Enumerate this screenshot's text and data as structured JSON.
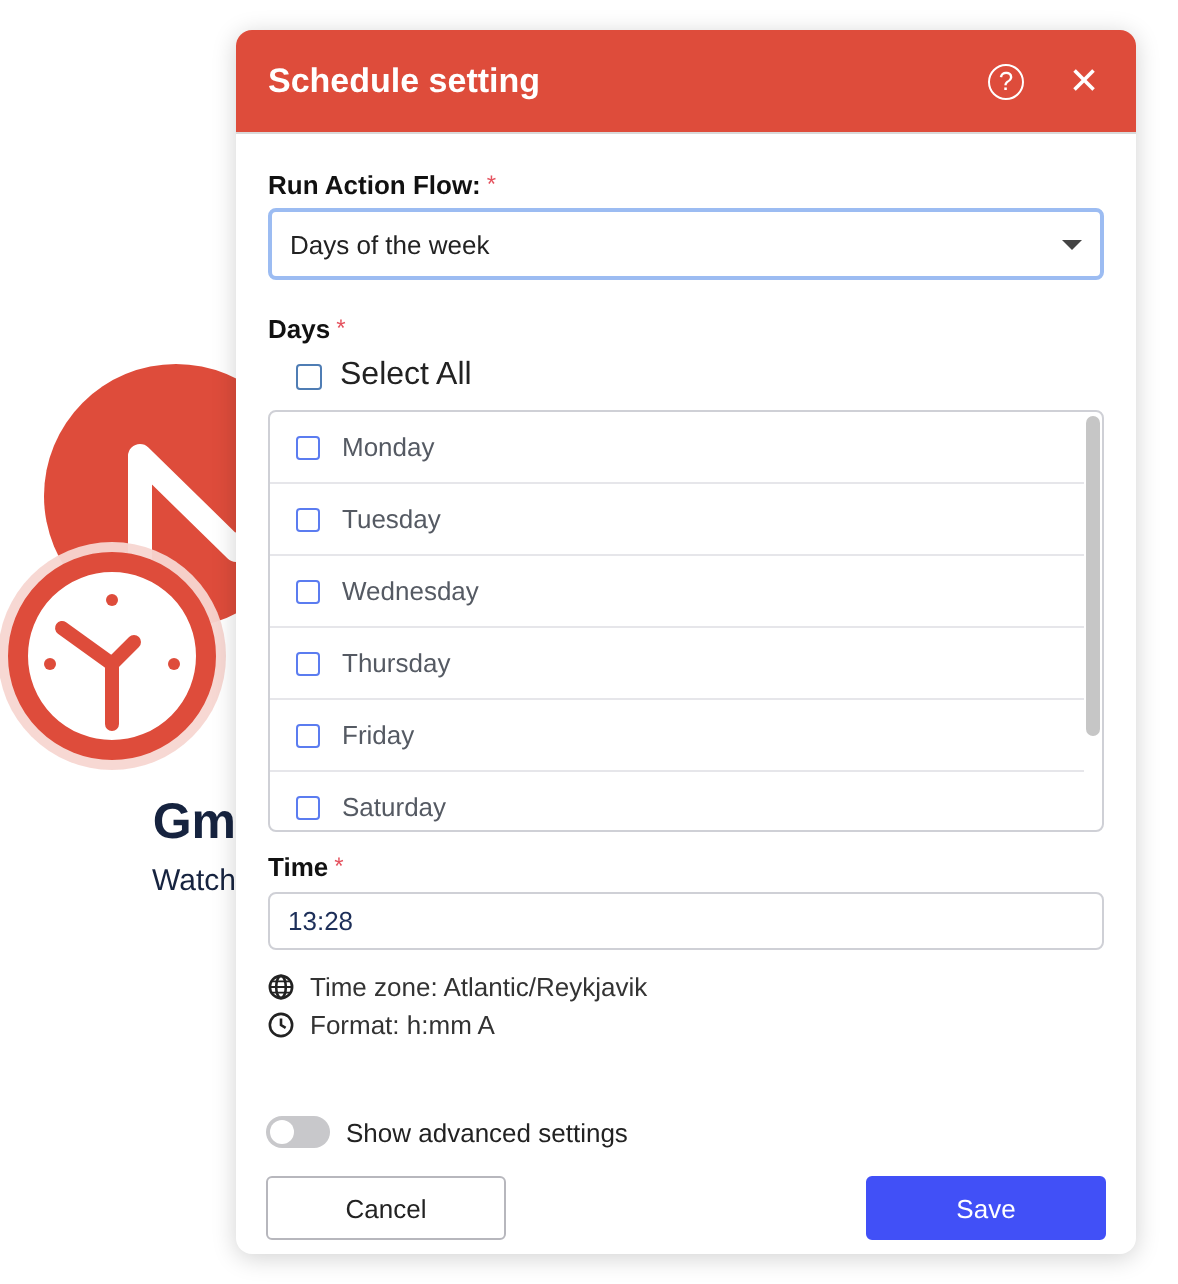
{
  "background": {
    "title": "Gm",
    "subtitle": "Watch"
  },
  "dialog": {
    "title": "Schedule setting",
    "help_icon": "?",
    "close_icon": "×"
  },
  "run_action_flow": {
    "label": "Run Action Flow:",
    "required_mark": "*",
    "value": "Days of the week"
  },
  "days": {
    "label": "Days",
    "required_mark": "*",
    "select_all": {
      "label": "Select All",
      "checked": false
    },
    "items": [
      {
        "label": "Monday",
        "checked": false
      },
      {
        "label": "Tuesday",
        "checked": false
      },
      {
        "label": "Wednesday",
        "checked": false
      },
      {
        "label": "Thursday",
        "checked": false
      },
      {
        "label": "Friday",
        "checked": false
      },
      {
        "label": "Saturday",
        "checked": false
      }
    ]
  },
  "time": {
    "label": "Time",
    "required_mark": "*",
    "value": "13:28",
    "time_zone": "Time zone: Atlantic/Reykjavik",
    "format": "Format: h:mm A"
  },
  "advanced_settings": {
    "label": "Show advanced settings",
    "on": false
  },
  "buttons": [
    {
      "label": "Cancel",
      "kind": "secondary"
    },
    {
      "label": "Save",
      "kind": "primary"
    }
  ]
}
